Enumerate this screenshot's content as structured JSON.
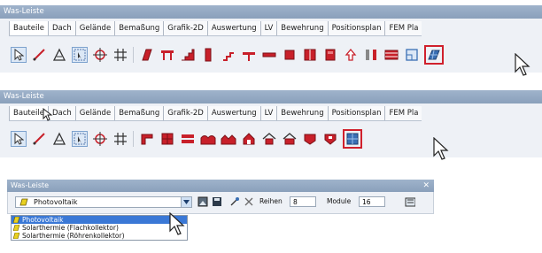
{
  "panels": [
    {
      "title": "Was-Leiste",
      "tabs": [
        "Bauteile",
        "Dach",
        "Gelände",
        "Bemaßung",
        "Grafik-2D",
        "Auswertung",
        "LV",
        "Bewehrung",
        "Positionsplan",
        "FEM Pla"
      ],
      "active_tab": "Bauteile"
    },
    {
      "title": "Was-Leiste",
      "tabs": [
        "Bauteile",
        "Dach",
        "Gelände",
        "Bemaßung",
        "Grafik-2D",
        "Auswertung",
        "LV",
        "Bewehrung",
        "Positionsplan",
        "FEM Pla"
      ],
      "active_tab": "Bauteile"
    }
  ],
  "float_panel": {
    "title": "Was-Leiste",
    "combo_value": "Photovoltaik",
    "dropdown_options": [
      "Photovoltaik",
      "Solarthermie (Flachkollektor)",
      "Solarthermie (Röhrenkollektor)"
    ],
    "selected_option": "Photovoltaik",
    "rows_label": "Reihen",
    "rows_value": "8",
    "modules_label": "Module",
    "modules_value": "16"
  },
  "colors": {
    "accent": "#3a78d6",
    "icon_red": "#c8202a",
    "highlight_frame": "#d0202c"
  }
}
